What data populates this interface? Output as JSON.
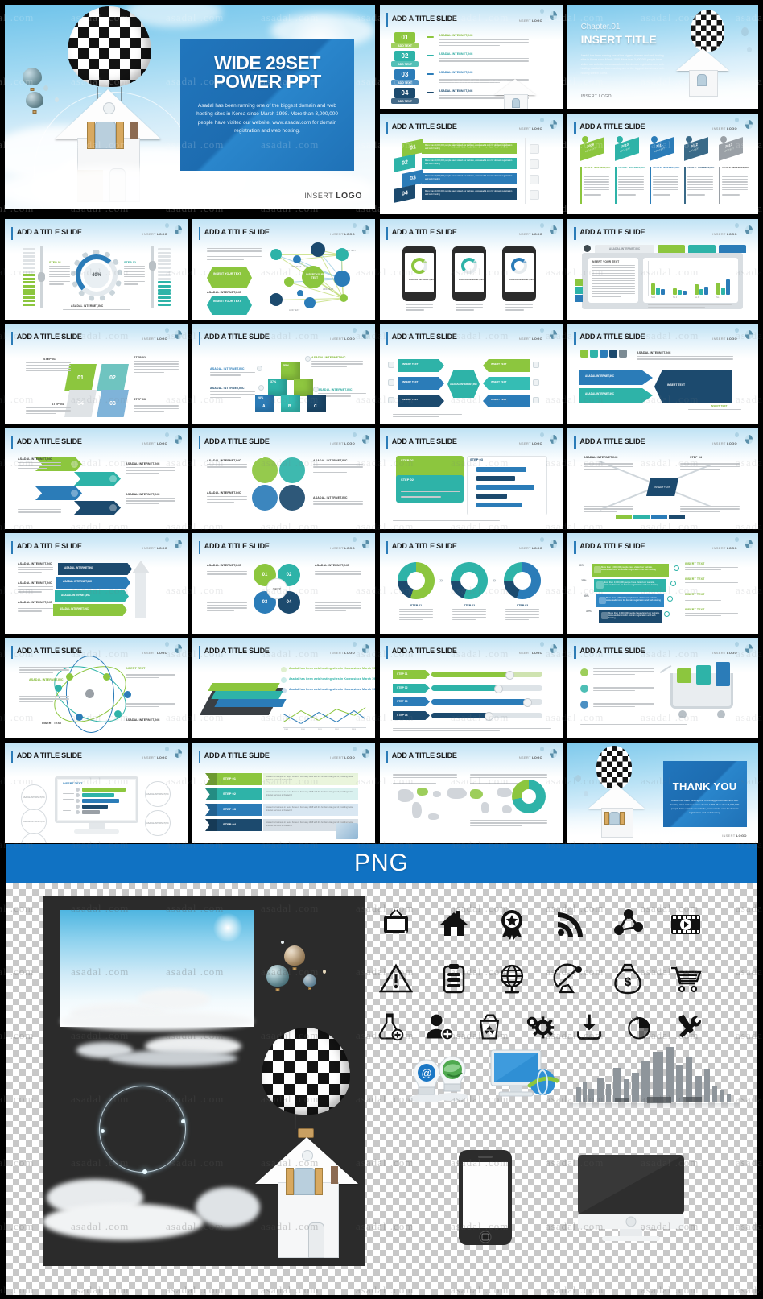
{
  "meta": {
    "watermark": "asadal .com",
    "brand": "asadal"
  },
  "colors": {
    "blue": "#1e72b8",
    "band_blue": "#1072c3",
    "green": "#8cc63e",
    "teal": "#2eb3a8",
    "mid_blue": "#2b7cb8",
    "navy": "#1c4a6e",
    "gray": "#9aa0a6"
  },
  "hero": {
    "title_line1": "WIDE 29SET",
    "title_line2": "POWER PPT",
    "body": "Asadal has been running one of the biggest domain and web hosting sites in Korea since March 1998. More than 3,000,000 people have visited our website, www.asadal.com for domain registration and web hosting.",
    "logo_prefix": "INSERT",
    "logo_text": "LOGO"
  },
  "slide_defaults": {
    "title": "ADD A TITLE SLIDE",
    "logo_prefix": "INSERT",
    "logo_text": "LOGO",
    "company": "ASADAL INTERNET,INC",
    "body_short": "Asadal has about 350 staffs including well experienced web designers, programmers, and server engineers.",
    "body_long": "started its business in Seoul Korea in February 1998 with the fundamental goal of providing better internet services to the world",
    "body_promo": "More than 3,000,000 people have visited our website, www.asadal.com for domain registration and web hosting",
    "body_hosting": "Asadal has been web hosting sites in Korea since March 1998.",
    "insert_text": "INSERT YOUR TEXT",
    "insert_text_short": "INSERT TEXT",
    "add_text": "ADD TEXT"
  },
  "chapter": {
    "eyebrow": "Chapter.01",
    "title": "INSERT TITLE",
    "body": "Asadal has been running one of the biggest domain and web hosting sites in Korea since March 1998. More than 3,000,000 people have visited our website, www.asadal.com for domain registration and web hosting. Asadal has been running one of the biggest domain and web hosting sites in Korea.",
    "logo": "INSERT LOGO"
  },
  "thankyou": {
    "title": "THANK YOU",
    "body": "Asadal has been running one of the biggest domain and web hosting sites in Korea since March 1998. More than 3,000,000 people have visited our website, www.asadal.com for domain registration and web hosting.",
    "logo_prefix": "INSERT",
    "logo_text": "LOGO"
  },
  "steps": {
    "numbers": [
      "01",
      "02",
      "03",
      "04"
    ],
    "labels": [
      "STEP 01",
      "STEP 02",
      "STEP 03",
      "STEP 04"
    ],
    "step_bars": [
      "STEP 01",
      "STEP 02",
      "STEP 03",
      "STEP 04"
    ],
    "add_text": "ADD TEXT"
  },
  "timeline": {
    "years": [
      "2009",
      "2010",
      "2011",
      "2012",
      "2013"
    ],
    "add_text": "ADD TEXT"
  },
  "percent": {
    "gauge": "40%",
    "phones": [
      "95%",
      "80%",
      "45%"
    ],
    "cubes": [
      "55%",
      "37%",
      "28%"
    ],
    "cube_letters": [
      "A",
      "B",
      "C"
    ],
    "funnel": [
      "50%",
      "25%",
      "50%",
      "30%"
    ],
    "triangle": [
      "25%",
      "30%",
      "50%"
    ]
  },
  "tabs": {
    "active": "ASADAL INTERNET,INC",
    "count": 3
  },
  "chart": {
    "categories": [
      "No.1",
      "No.2",
      "No.3",
      "No.4"
    ],
    "yticks": [
      "1",
      "2",
      "3",
      "4",
      "5",
      "6"
    ]
  },
  "line_chart": {
    "xticks": [
      "2009",
      "2010",
      "2011",
      "2012",
      "2013"
    ],
    "yticks": [
      "100",
      "200",
      "300",
      "400",
      "500"
    ]
  },
  "png": {
    "band_label": "PNG",
    "icons_row1": [
      "tv-icon",
      "home-icon",
      "award-badge-icon",
      "rss-icon",
      "share-network-icon",
      "film-play-icon"
    ],
    "icons_row2": [
      "warning-triangle-icon",
      "clipboard-icon",
      "globe-stand-icon",
      "satellite-dish-icon",
      "money-bag-icon",
      "shopping-cart-icon"
    ],
    "icons_row3": [
      "flask-add-icon",
      "user-add-icon",
      "recycle-bin-icon",
      "gears-icon",
      "download-tray-icon",
      "pie-mouse-icon",
      "tools-icon"
    ],
    "objects": [
      "lightbulb-globe-at-icon",
      "monitor-browser-icon",
      "city-skyline-image",
      "smartphone-mockup",
      "imac-monitor-mockup"
    ],
    "assets": [
      "sky-background-image",
      "clouds-image",
      "lens-flare-ring-image",
      "checkered-balloon-house-image"
    ]
  },
  "rows": [
    {
      "row": 2,
      "slides": [
        {
          "name": "slider-gauge-slide"
        },
        {
          "name": "network-diagram-slide"
        },
        {
          "name": "mobile-phones-slide"
        },
        {
          "name": "tabbed-chart-slide"
        }
      ]
    }
  ]
}
